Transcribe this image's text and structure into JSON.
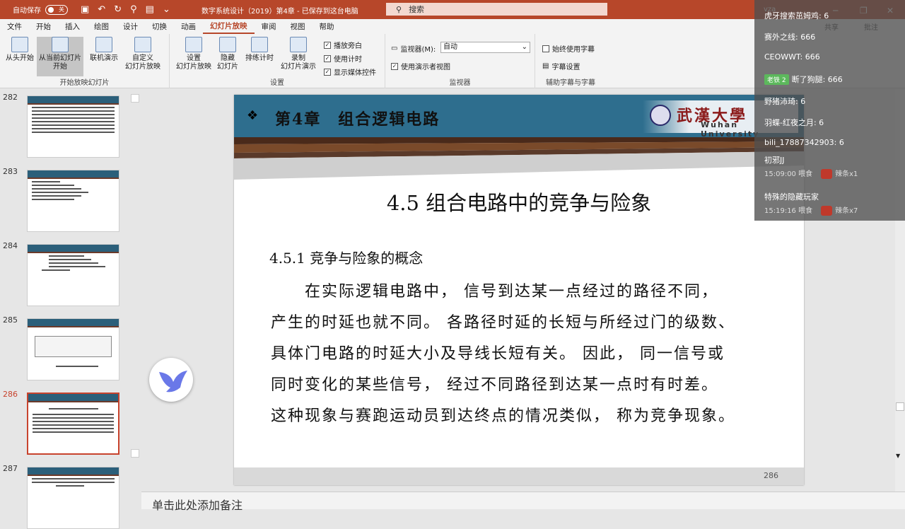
{
  "titlebar": {
    "autosave_label": "自动保存",
    "autosave_state": "关",
    "doc_title": "数字系统设计（2019）第4章 - 已保存到这台电脑",
    "search_placeholder": "搜索",
    "user": "vza",
    "accent": "#b7472a"
  },
  "ribbon": {
    "tabs": [
      "文件",
      "开始",
      "插入",
      "绘图",
      "设计",
      "切换",
      "动画",
      "幻灯片放映",
      "审阅",
      "视图",
      "帮助"
    ],
    "active_tab": "幻灯片放映",
    "share_label": "共享",
    "notes_label": "批注",
    "groups": {
      "start": {
        "label": "开始放映幻灯片",
        "from_start": "从头开始",
        "from_current_1": "从当前幻灯片",
        "from_current_2": "开始",
        "online": "联机演示",
        "custom_1": "自定义",
        "custom_2": "幻灯片放映"
      },
      "setup": {
        "label": "设置",
        "setup_1": "设置",
        "setup_2": "幻灯片放映",
        "hide_1": "隐藏",
        "hide_2": "幻灯片",
        "rehearse": "排练计时",
        "record_1": "录制",
        "record_2": "幻灯片演示",
        "play_narration": "播放旁白",
        "use_timings": "使用计时",
        "show_media": "显示媒体控件"
      },
      "monitors": {
        "label": "监视器",
        "monitor_label": "监视器(M):",
        "monitor_value": "自动",
        "presenter_view": "使用演示者视图"
      },
      "captions": {
        "label": "辅助字幕与字幕",
        "always_subtitles": "始终使用字幕",
        "subtitle_settings": "字幕设置"
      }
    }
  },
  "thumbnails": [
    {
      "num": "282",
      "selected": false
    },
    {
      "num": "283",
      "selected": false
    },
    {
      "num": "284",
      "selected": false
    },
    {
      "num": "285",
      "selected": false
    },
    {
      "num": "286",
      "selected": true
    },
    {
      "num": "287",
      "selected": false
    }
  ],
  "slide": {
    "chapter": "第4章　组合逻辑电路",
    "logo_cn": "武漢大學",
    "logo_en": "Wuhan University",
    "title": "4.5  组合电路中的竞争与险象",
    "subheading": "4.5.1  竞争与险象的概念",
    "paragraph": [
      "　　在实际逻辑电路中， 信号到达某一点经过的路径不同，",
      "产生的时延也就不同。 各路径时延的长短与所经过门的级数、",
      "具体门电路的时延大小及导线长短有关。 因此， 同一信号或",
      "同时变化的某些信号， 经过不同路径到达某一点时有时差。",
      "这种现象与赛跑运动员到达终点的情况类似， 称为竞争现象。"
    ],
    "page_number": "286"
  },
  "notes_placeholder": "单击此处添加备注",
  "chat": [
    {
      "text": "虎牙搜索茁姆鸡: 6"
    },
    {
      "text": "赛外之线: 666"
    },
    {
      "text": "CEOWWT:      666"
    },
    {
      "badge": "老铁 2",
      "text": "断了狗腿: 666"
    },
    {
      "text": "野猪沛琦: 6"
    },
    {
      "text": "羽蝶-红夜之月: 6"
    },
    {
      "text": "bili_17887342903: 6"
    },
    {
      "text": "初邪JJ"
    },
    {
      "gift_time": "15:09:00 喂食",
      "gift": "辣条x1"
    },
    {
      "text": "特殊的隐藏玩家"
    },
    {
      "gift_time": "15:19:16 喂食",
      "gift": "辣条x7"
    }
  ]
}
